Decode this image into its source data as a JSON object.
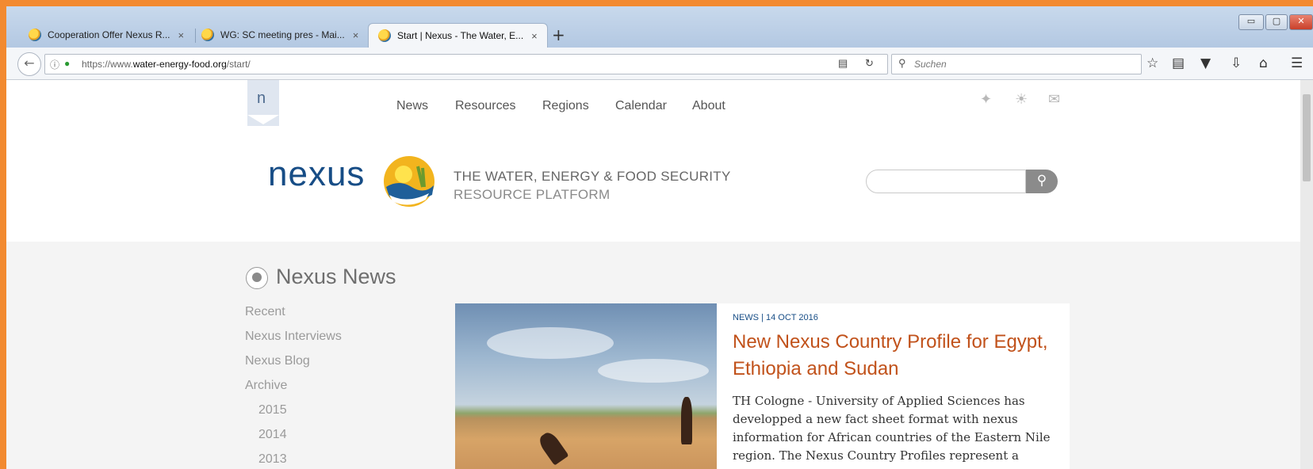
{
  "tabs": [
    {
      "title": "Cooperation Offer Nexus R..."
    },
    {
      "title": "WG: SC meeting pres - Mai..."
    },
    {
      "title": "Start | Nexus - The Water, E..."
    }
  ],
  "tab_close": "×",
  "new_tab": "+",
  "window_controls": {
    "minimize": "▭",
    "maximize": "▢",
    "close": "✕"
  },
  "navbar": {
    "url_prefix": "https://www.",
    "url_domain": "water-energy-food.org",
    "url_path": "/start/",
    "search_placeholder": "Suchen"
  },
  "icons": {
    "back": "back-arrow-icon",
    "info": "info-icon",
    "lock": "lock-icon",
    "reader": "reader-view-icon",
    "reload": "reload-icon",
    "search": "search-icon",
    "bookmark": "star-icon",
    "library": "library-icon",
    "pocket": "pocket-icon",
    "download": "download-icon",
    "home": "home-icon",
    "menu": "hamburger-menu-icon",
    "twitter": "twitter-icon",
    "rss": "rss-icon",
    "mail": "mail-icon"
  },
  "site": {
    "ntab_letter": "n",
    "menu": [
      "News",
      "Resources",
      "Regions",
      "Calendar",
      "About"
    ],
    "logo_text": "nexus",
    "tagline_line1": "THE WATER, ENERGY & FOOD SECURITY",
    "tagline_line2": "RESOURCE PLATFORM"
  },
  "news_section": {
    "title": "Nexus News",
    "nav": [
      "Recent",
      "Nexus Interviews",
      "Nexus Blog",
      "Archive"
    ],
    "years": [
      "2015",
      "2014",
      "2013"
    ]
  },
  "article": {
    "meta": "NEWS | 14 OCT 2016",
    "headline": "New Nexus Country Profile for Egypt, Ethiopia and Sudan",
    "excerpt": "TH Cologne - University of Applied Sciences has developped a new fact sheet format with nexus information for African countries of the Eastern Nile region. The Nexus Country Profiles represent a policy-"
  },
  "colors": {
    "frame": "#f28a30",
    "brand_blue": "#174d86",
    "headline_orange": "#c1521b"
  }
}
